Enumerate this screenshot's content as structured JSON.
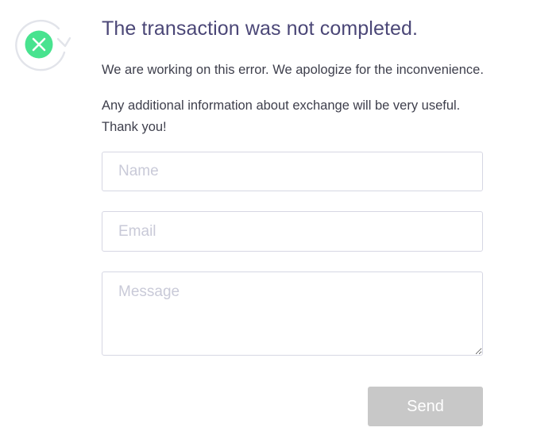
{
  "status": {
    "icon": "error-cross-icon",
    "accent_color": "#48e38f",
    "ring_color": "#e2e4ea"
  },
  "header": {
    "title": "The transaction was not completed.",
    "subtitle": "We are working on this error. We apologize for the inconvenience.",
    "info_line_1": "Any additional information about exchange will be very useful.",
    "info_line_2": "Thank you!"
  },
  "form": {
    "name_placeholder": "Name",
    "email_placeholder": "Email",
    "message_placeholder": "Message",
    "send_label": "Send",
    "send_color": "#c8c8c8"
  }
}
